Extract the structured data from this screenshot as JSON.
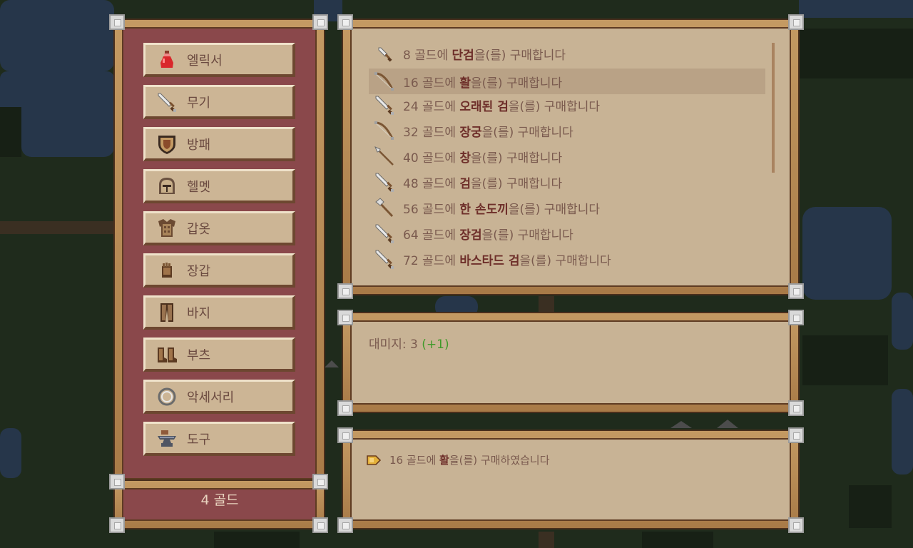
{
  "shop": {
    "categories": [
      {
        "label": "엘릭서",
        "icon": "potion-icon"
      },
      {
        "label": "무기",
        "icon": "sword-icon"
      },
      {
        "label": "방패",
        "icon": "shield-icon"
      },
      {
        "label": "헬멧",
        "icon": "helmet-icon"
      },
      {
        "label": "갑옷",
        "icon": "armor-icon"
      },
      {
        "label": "장갑",
        "icon": "glove-icon"
      },
      {
        "label": "바지",
        "icon": "pants-icon"
      },
      {
        "label": "부츠",
        "icon": "boots-icon"
      },
      {
        "label": "악세서리",
        "icon": "ring-icon"
      },
      {
        "label": "도구",
        "icon": "anvil-icon"
      }
    ],
    "gold": "4 골드",
    "items": [
      {
        "price": "8 골드에",
        "name": "단검",
        "suffix": "을(를) 구매합니다",
        "icon": "dagger-icon"
      },
      {
        "price": "16 골드에",
        "name": "활",
        "suffix": "을(를) 구매합니다",
        "icon": "bow-icon"
      },
      {
        "price": "24 골드에",
        "name": "오래된 검",
        "suffix": "을(를) 구매합니다",
        "icon": "sword-icon"
      },
      {
        "price": "32 골드에",
        "name": "장궁",
        "suffix": "을(를) 구매합니다",
        "icon": "bow-icon"
      },
      {
        "price": "40 골드에",
        "name": "창",
        "suffix": "을(를) 구매합니다",
        "icon": "spear-icon"
      },
      {
        "price": "48 골드에",
        "name": "검",
        "suffix": "을(를) 구매합니다",
        "icon": "sword-icon"
      },
      {
        "price": "56 골드에",
        "name": "한 손도끼",
        "suffix": "을(를) 구매합니다",
        "icon": "axe-icon"
      },
      {
        "price": "64 골드에",
        "name": "장검",
        "suffix": "을(를) 구매합니다",
        "icon": "sword-icon"
      },
      {
        "price": "72 골드에",
        "name": "바스타드 검",
        "suffix": "을(를) 구매합니다",
        "icon": "sword-icon"
      }
    ],
    "selected_index": 1,
    "stat": {
      "label": "대미지: 3",
      "bonus": "(+1)"
    },
    "log": {
      "price": "16 골드에",
      "name": "활",
      "suffix": "을(를) 구매하였습니다",
      "icon": "arrow-tag-icon"
    }
  },
  "colors": {
    "parchment": "#c8b395",
    "red_panel": "#8a484b",
    "wood": "#b8874f",
    "text": "#7a5a4e",
    "item_name": "#6e2f2a",
    "bonus": "#3f9a2a",
    "selected_row": "#b9a286"
  }
}
